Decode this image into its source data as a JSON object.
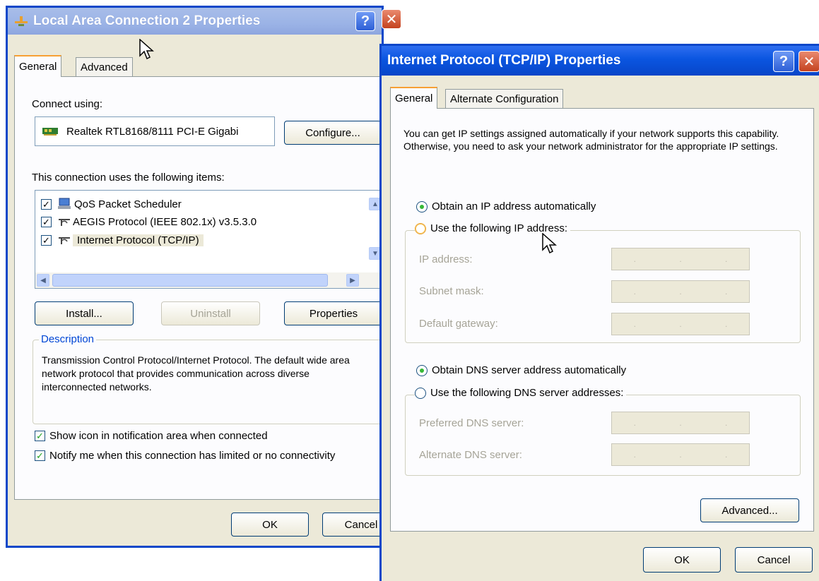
{
  "dialog1": {
    "title": "Local Area Connection 2 Properties",
    "tabs": [
      "General",
      "Advanced"
    ],
    "connect_using_label": "Connect using:",
    "adapter_name": "Realtek RTL8168/8111 PCI-E Gigabi",
    "configure_button": "Configure...",
    "items_label": "This connection uses the following items:",
    "items": [
      {
        "label": "QoS Packet Scheduler",
        "checked": true,
        "icon": "scheduler-icon"
      },
      {
        "label": "AEGIS Protocol (IEEE 802.1x) v3.5.3.0",
        "checked": true,
        "icon": "protocol-icon"
      },
      {
        "label": "Internet Protocol (TCP/IP)",
        "checked": true,
        "icon": "protocol-icon"
      }
    ],
    "install_button": "Install...",
    "uninstall_button": "Uninstall",
    "properties_button": "Properties",
    "description_legend": "Description",
    "description_text": "Transmission Control Protocol/Internet Protocol. The default wide area network protocol that provides communication across diverse interconnected networks.",
    "show_icon_label": "Show icon in notification area when connected",
    "notify_label": "Notify me when this connection has limited or no connectivity",
    "ok_button": "OK",
    "cancel_button": "Cancel"
  },
  "dialog2": {
    "title": "Internet Protocol (TCP/IP) Properties",
    "tabs": [
      "General",
      "Alternate Configuration"
    ],
    "intro_text": "You can get IP settings assigned automatically if your network supports this capability. Otherwise, you need to ask your network administrator for the appropriate IP settings.",
    "obtain_ip_label": "Obtain an IP address automatically",
    "use_ip_label": "Use the following IP address:",
    "ip_address_label": "IP address:",
    "subnet_mask_label": "Subnet mask:",
    "default_gateway_label": "Default gateway:",
    "obtain_dns_label": "Obtain DNS server address automatically",
    "use_dns_label": "Use the following DNS server addresses:",
    "preferred_dns_label": "Preferred DNS server:",
    "alternate_dns_label": "Alternate DNS server:",
    "advanced_button": "Advanced...",
    "ok_button": "OK",
    "cancel_button": "Cancel"
  },
  "colors": {
    "title_active": "#0a55e0",
    "dialog_bg": "#ece9d8",
    "close_red": "#c4421f"
  }
}
